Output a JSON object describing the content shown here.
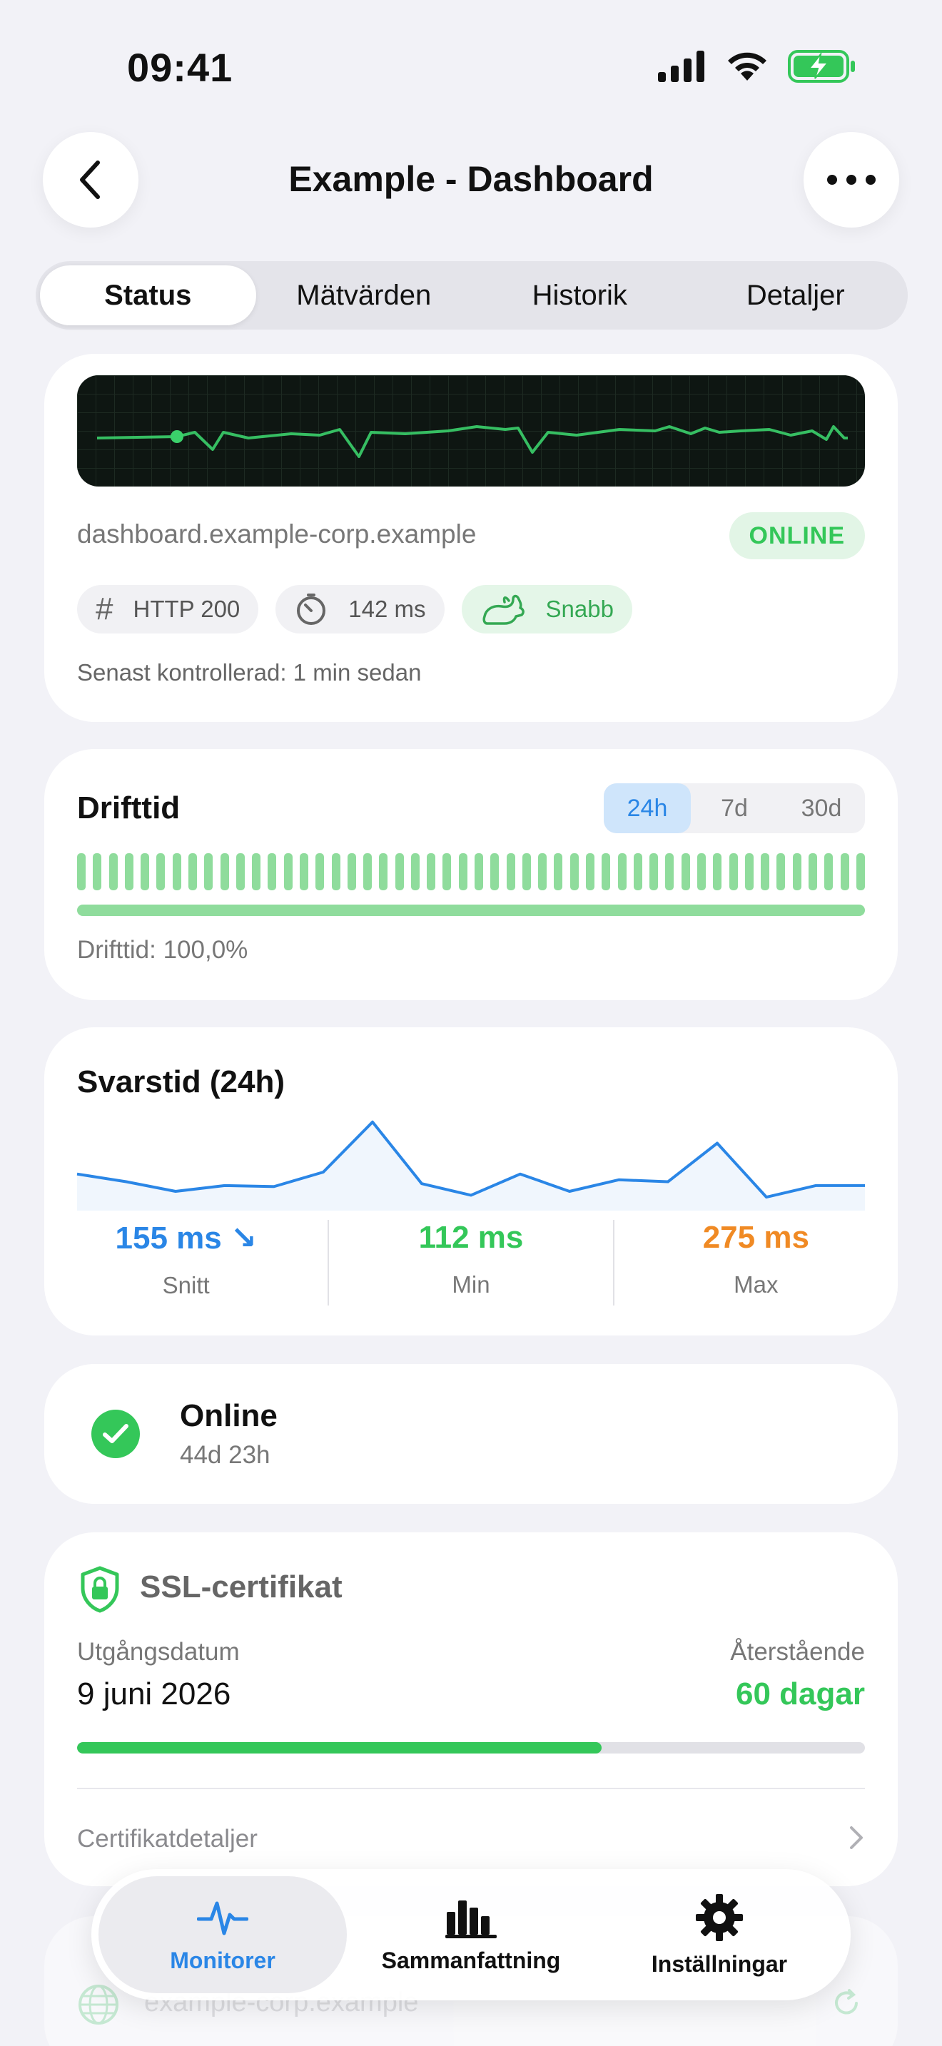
{
  "status_bar": {
    "time": "09:41"
  },
  "nav": {
    "title": "Example - Dashboard"
  },
  "segments": [
    {
      "label": "Status",
      "active": true
    },
    {
      "label": "Mätvärden",
      "active": false
    },
    {
      "label": "Historik",
      "active": false
    },
    {
      "label": "Detaljer",
      "active": false
    }
  ],
  "status_card": {
    "url": "dashboard.example-corp.example",
    "status": "ONLINE",
    "chips": [
      {
        "icon": "hash-icon",
        "label": "HTTP 200"
      },
      {
        "icon": "timer-icon",
        "label": "142 ms"
      },
      {
        "icon": "rabbit-icon",
        "label": "Snabb"
      }
    ],
    "last_checked": "Senast kontrollerad: 1 min sedan"
  },
  "uptime_card": {
    "title": "Drifttid",
    "ranges": [
      "24h",
      "7d",
      "30d"
    ],
    "selected_range": "24h",
    "bar_count": 50,
    "uptime_percent": 100.0,
    "summary": "Drifttid: 100,0%",
    "colors": {
      "bar": "#8fdc9c",
      "selected_range_bg": "#cfe5fb",
      "selected_range_text": "#2a86e6"
    }
  },
  "response_card": {
    "title": "Svarstid (24h)",
    "stats": [
      {
        "value": "155 ms ↘",
        "label": "Snitt",
        "color": "#2a86e6"
      },
      {
        "value": "112 ms",
        "label": "Min",
        "color": "#34c759"
      },
      {
        "value": "275 ms",
        "label": "Max",
        "color": "#f08a24"
      }
    ],
    "chart_data": {
      "type": "line",
      "series": [
        {
          "values": [
            158,
            150,
            140,
            146,
            145,
            160,
            212,
            148,
            136,
            158,
            140,
            152,
            150,
            190,
            134,
            146,
            146
          ]
        }
      ],
      "color": "#2a86e6"
    }
  },
  "online_card": {
    "title": "Online",
    "duration": "44d 23h"
  },
  "ssl_card": {
    "title": "SSL-certifikat",
    "expiry_label": "Utgångsdatum",
    "expiry_value": "9 juni 2026",
    "remaining_label": "Återstående",
    "remaining_value": "60 dagar",
    "progress_fraction": 0.666,
    "details_label": "Certifikatdetaljer"
  },
  "domain_card": {
    "domain": "example-corp.example"
  },
  "tabbar": [
    {
      "label": "Monitorer",
      "icon": "pulse-icon",
      "active": true
    },
    {
      "label": "Sammanfattning",
      "icon": "bar-chart-icon",
      "active": false
    },
    {
      "label": "Inställningar",
      "icon": "gear-icon",
      "active": false
    }
  ]
}
